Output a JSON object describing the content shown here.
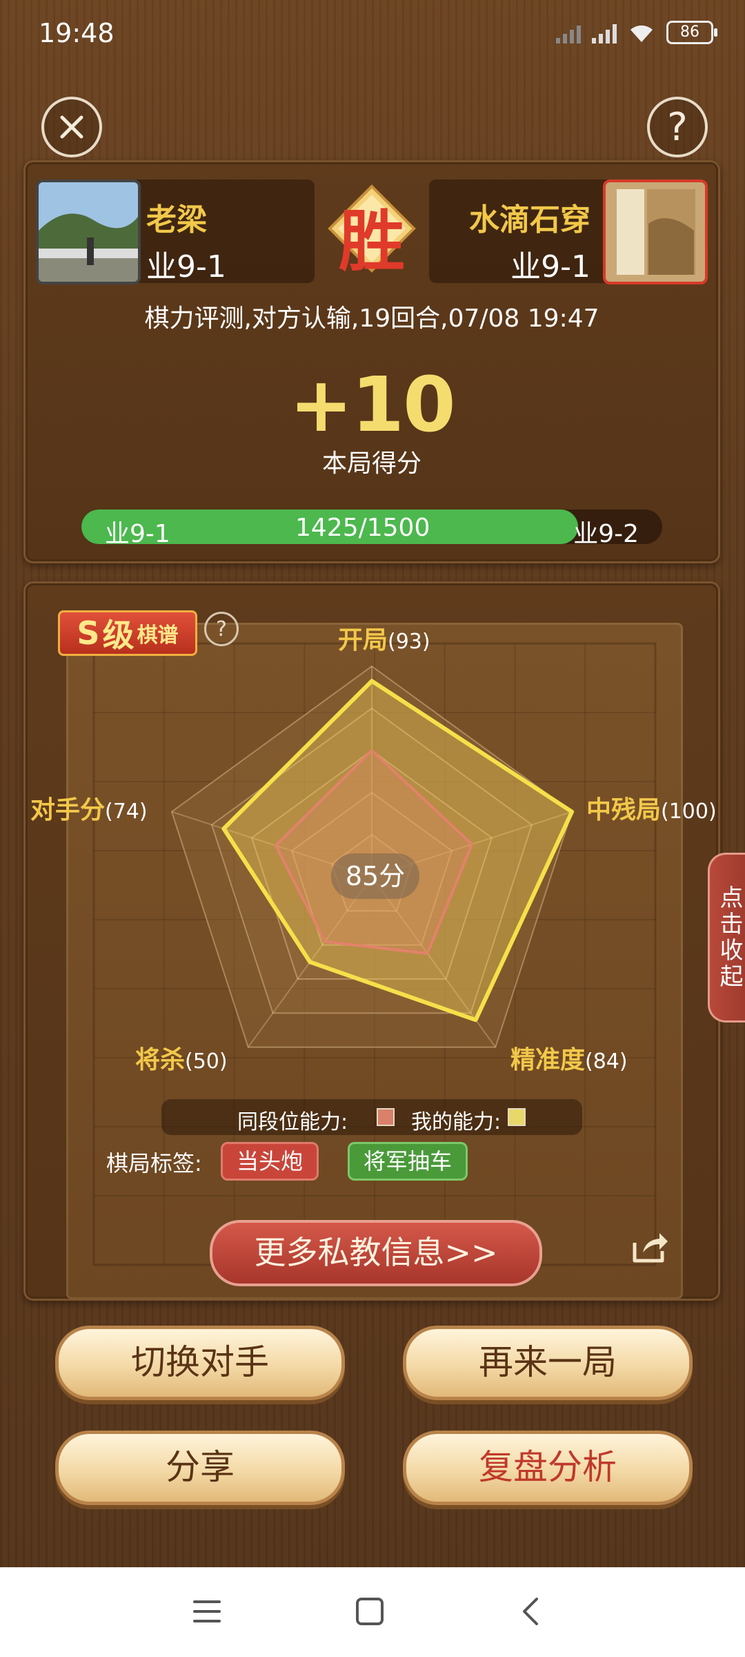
{
  "status_bar": {
    "time": "19:48",
    "battery": "86"
  },
  "header": {
    "close_icon": "close-icon",
    "help_icon": "question-icon",
    "help_text": "?"
  },
  "players": {
    "left": {
      "name": "老梁",
      "rank": "业9-1"
    },
    "right": {
      "name": "水滴石穿",
      "rank": "业9-1"
    },
    "result_badge": "胜"
  },
  "game_meta": "棋力评测,对方认输,19回合,07/08 19:47",
  "score": {
    "value": "+10",
    "label": "本局得分"
  },
  "progress": {
    "current_rank": "业9-1",
    "next_rank": "业9-2",
    "text": "1425/1500",
    "current": 1425,
    "max": 1500
  },
  "analysis": {
    "grade_letter": "S",
    "grade_text": "级",
    "grade_suffix": "棋谱",
    "help_text": "?",
    "center_score": "85分",
    "axes": [
      {
        "name": "开局",
        "value": "(93)"
      },
      {
        "name": "中残局",
        "value": "(100)"
      },
      {
        "name": "精准度",
        "value": "(84)"
      },
      {
        "name": "将杀",
        "value": "(50)"
      },
      {
        "name": "对手分",
        "value": "(74)"
      }
    ],
    "legend": {
      "peer": "同段位能力:",
      "mine": "我的能力:"
    },
    "tags_label": "棋局标签:",
    "tags": [
      "当头炮",
      "将军抽车"
    ],
    "more_button": "更多私教信息>>",
    "side_tab": "点击收起"
  },
  "chart_data": {
    "type": "radar",
    "categories": [
      "开局",
      "中残局",
      "精准度",
      "将杀",
      "对手分"
    ],
    "series": [
      {
        "name": "我的能力",
        "values": [
          93,
          100,
          84,
          50,
          74
        ]
      },
      {
        "name": "同段位能力",
        "values": [
          60,
          50,
          45,
          38,
          48
        ]
      }
    ],
    "ylim": [
      0,
      100
    ],
    "colors": {
      "mine": "#f5e04a",
      "peer": "#e2826a"
    }
  },
  "buttons": {
    "switch": "切换对手",
    "again": "再来一局",
    "share": "分享",
    "review": "复盘分析"
  },
  "colors": {
    "accent_gold": "#f2c84a",
    "progress_green": "#4cb84e",
    "red": "#c0392b"
  }
}
